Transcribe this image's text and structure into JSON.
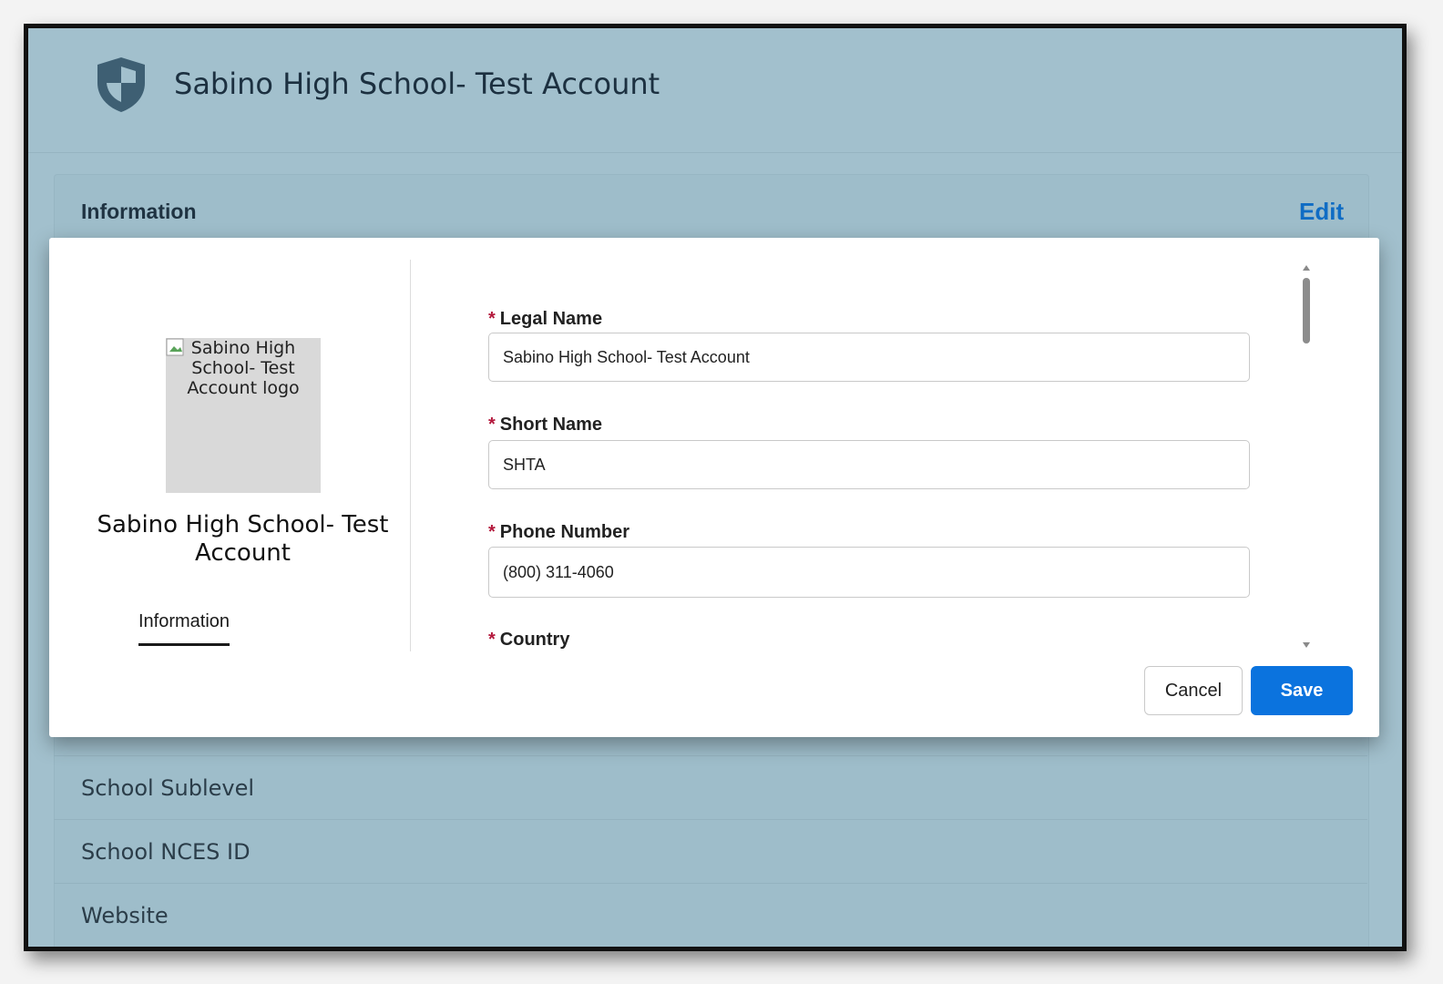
{
  "header": {
    "title": "Sabino High School- Test Account",
    "icon": "shield-icon"
  },
  "info_section": {
    "heading": "Information",
    "edit_label": "Edit",
    "background_fields": [
      "School Sublevel",
      "School NCES ID",
      "Website"
    ]
  },
  "modal": {
    "logo_alt": "Sabino High School- Test Account logo",
    "account_name": "Sabino High School- Test Account",
    "side_tab": "Information",
    "required_marker": "*",
    "fields": {
      "legal_name": {
        "label": "Legal Name",
        "value": "Sabino High School- Test Account"
      },
      "short_name": {
        "label": "Short Name",
        "value": "SHTA"
      },
      "phone_number": {
        "label": "Phone Number",
        "value": "(800) 311-4060"
      },
      "country": {
        "label": "Country"
      }
    },
    "cancel_label": "Cancel",
    "save_label": "Save"
  },
  "colors": {
    "page_overlay": "#a2c0cd",
    "link": "#0f6cc4",
    "primary_button": "#0b73de",
    "required": "#b3173b"
  }
}
